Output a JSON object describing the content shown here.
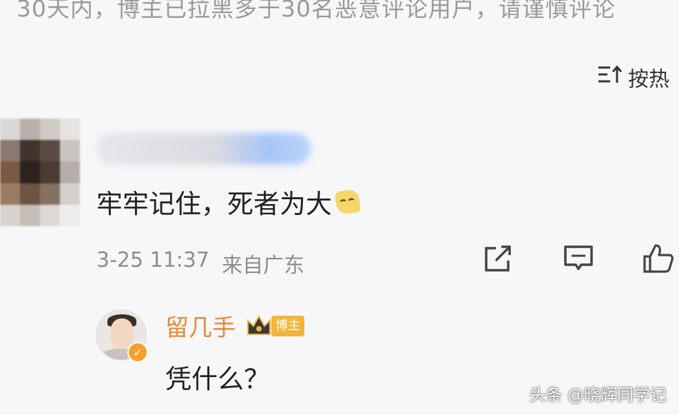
{
  "notice": {
    "text": "30天内，博主已拉黑多于30名恶意评论用户，请谨慎评论"
  },
  "sort": {
    "label": "按热",
    "icon": "sort-icon"
  },
  "comment": {
    "text": "牢牢记住，死者为大",
    "emoji": "smirk-emoji",
    "date": "3-25 11:37",
    "location": "来自广东",
    "actions": [
      "share-icon",
      "comment-icon",
      "like-icon"
    ]
  },
  "reply": {
    "username": "留几手",
    "badge_label": "博主",
    "text": "凭什么？",
    "verify_icon": "verified-icon"
  },
  "watermark": {
    "text": "头条 @晓辉同学记"
  },
  "colors": {
    "username_orange": "#e8893a",
    "badge_gold": "#f2b43b",
    "meta_gray": "#8d8d8d",
    "background": "#f7f7f9"
  }
}
